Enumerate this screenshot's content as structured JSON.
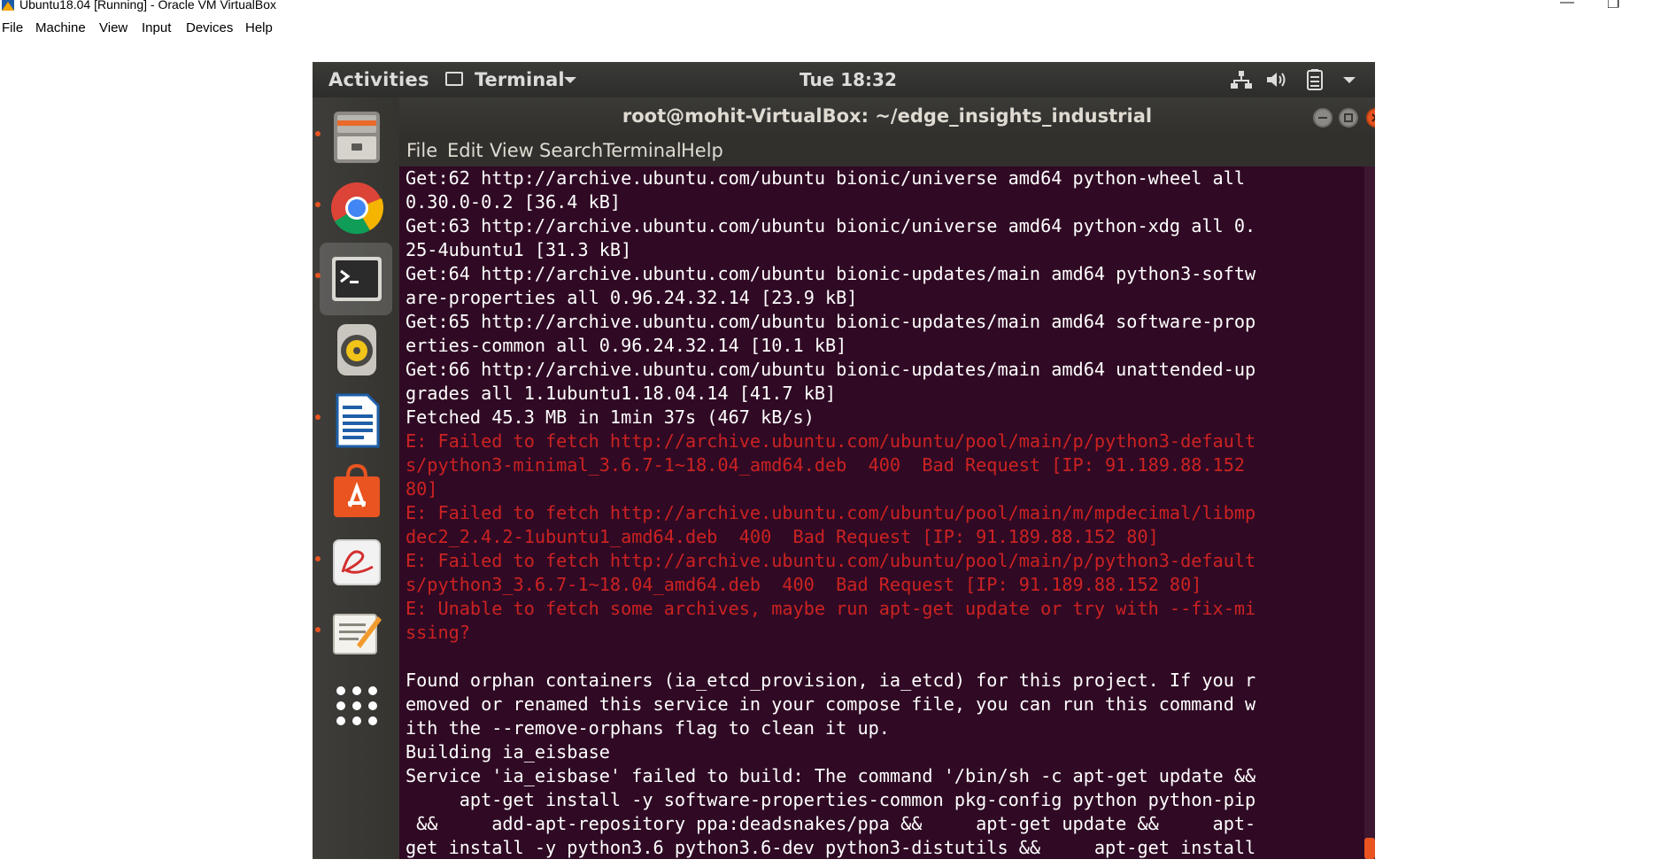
{
  "host": {
    "title": "Ubuntu18.04 [Running] - Oracle VM VirtualBox",
    "menu": [
      "File",
      "Machine",
      "View",
      "Input",
      "Devices",
      "Help"
    ],
    "minimize_glyph": "—",
    "restore_glyph": "❐"
  },
  "topbar": {
    "activities": "Activities",
    "app_label": "Terminal",
    "clock": "Tue 18:32"
  },
  "dock": {
    "items": [
      {
        "icon": "files-icon",
        "running": true
      },
      {
        "icon": "chrome-icon",
        "running": true
      },
      {
        "icon": "terminal-icon",
        "running": true,
        "active": true
      },
      {
        "icon": "speaker-icon",
        "running": false
      },
      {
        "icon": "writer-icon",
        "running": true
      },
      {
        "icon": "software-center-icon",
        "running": false
      },
      {
        "icon": "pdf-reader-icon",
        "running": true
      },
      {
        "icon": "text-editor-icon",
        "running": true
      },
      {
        "icon": "show-apps-icon",
        "running": false
      }
    ]
  },
  "terminal": {
    "title": "root@mohit-VirtualBox: ~/edge_insights_industrial",
    "menu": [
      "File",
      "Edit",
      "View",
      "Search",
      "Terminal",
      "Help"
    ],
    "lines": [
      {
        "text": "Get:62 http://archive.ubuntu.com/ubuntu bionic/universe amd64 python-wheel all",
        "err": false
      },
      {
        "text": "0.30.0-0.2 [36.4 kB]",
        "err": false
      },
      {
        "text": "Get:63 http://archive.ubuntu.com/ubuntu bionic/universe amd64 python-xdg all 0.",
        "err": false
      },
      {
        "text": "25-4ubuntu1 [31.3 kB]",
        "err": false
      },
      {
        "text": "Get:64 http://archive.ubuntu.com/ubuntu bionic-updates/main amd64 python3-softw",
        "err": false
      },
      {
        "text": "are-properties all 0.96.24.32.14 [23.9 kB]",
        "err": false
      },
      {
        "text": "Get:65 http://archive.ubuntu.com/ubuntu bionic-updates/main amd64 software-prop",
        "err": false
      },
      {
        "text": "erties-common all 0.96.24.32.14 [10.1 kB]",
        "err": false
      },
      {
        "text": "Get:66 http://archive.ubuntu.com/ubuntu bionic-updates/main amd64 unattended-up",
        "err": false
      },
      {
        "text": "grades all 1.1ubuntu1.18.04.14 [41.7 kB]",
        "err": false
      },
      {
        "text": "Fetched 45.3 MB in 1min 37s (467 kB/s)",
        "err": false
      },
      {
        "text": "E: Failed to fetch http://archive.ubuntu.com/ubuntu/pool/main/p/python3-default",
        "err": true
      },
      {
        "text": "s/python3-minimal_3.6.7-1~18.04_amd64.deb  400  Bad Request [IP: 91.189.88.152",
        "err": true
      },
      {
        "text": "80]",
        "err": true
      },
      {
        "text": "E: Failed to fetch http://archive.ubuntu.com/ubuntu/pool/main/m/mpdecimal/libmp",
        "err": true
      },
      {
        "text": "dec2_2.4.2-1ubuntu1_amd64.deb  400  Bad Request [IP: 91.189.88.152 80]",
        "err": true
      },
      {
        "text": "E: Failed to fetch http://archive.ubuntu.com/ubuntu/pool/main/p/python3-default",
        "err": true
      },
      {
        "text": "s/python3_3.6.7-1~18.04_amd64.deb  400  Bad Request [IP: 91.189.88.152 80]",
        "err": true
      },
      {
        "text": "E: Unable to fetch some archives, maybe run apt-get update or try with --fix-mi",
        "err": true
      },
      {
        "text": "ssing?",
        "err": true
      },
      {
        "text": "",
        "err": false
      },
      {
        "text": "Found orphan containers (ia_etcd_provision, ia_etcd) for this project. If you r",
        "err": false
      },
      {
        "text": "emoved or renamed this service in your compose file, you can run this command w",
        "err": false
      },
      {
        "text": "ith the --remove-orphans flag to clean it up.",
        "err": false
      },
      {
        "text": "Building ia_eisbase",
        "err": false
      },
      {
        "text": "Service 'ia_eisbase' failed to build: The command '/bin/sh -c apt-get update &&",
        "err": false
      },
      {
        "text": "     apt-get install -y software-properties-common pkg-config python python-pip",
        "err": false
      },
      {
        "text": " &&     add-apt-repository ppa:deadsnakes/ppa &&     apt-get update &&     apt-",
        "err": false
      },
      {
        "text": "get install -y python3.6 python3.6-dev python3-distutils &&     apt-get install",
        "err": false
      }
    ]
  },
  "colors": {
    "terminal_bg": "#300a24",
    "error_text": "#cc2222",
    "accent": "#e95420"
  }
}
